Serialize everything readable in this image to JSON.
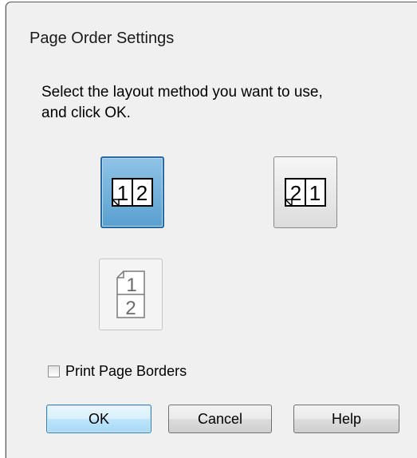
{
  "dialog": {
    "title": "Page Order Settings",
    "instruction_line1": "Select the layout method you want to use,",
    "instruction_line2": "and click OK."
  },
  "layout_options": [
    {
      "name": "left-to-right",
      "pages": [
        "1",
        "2"
      ],
      "selected": true
    },
    {
      "name": "right-to-left",
      "pages": [
        "2",
        "1"
      ],
      "selected": false
    },
    {
      "name": "top-to-bottom",
      "pages": [
        "1",
        "2"
      ],
      "selected": false
    }
  ],
  "print_page_borders": {
    "label": "Print Page Borders",
    "checked": false
  },
  "buttons": {
    "ok": "OK",
    "cancel": "Cancel",
    "help": "Help"
  },
  "colors": {
    "selected_fill": "#5aa0d0",
    "selected_border": "#2a6aa3",
    "default_button_border": "#3c7fb1"
  }
}
